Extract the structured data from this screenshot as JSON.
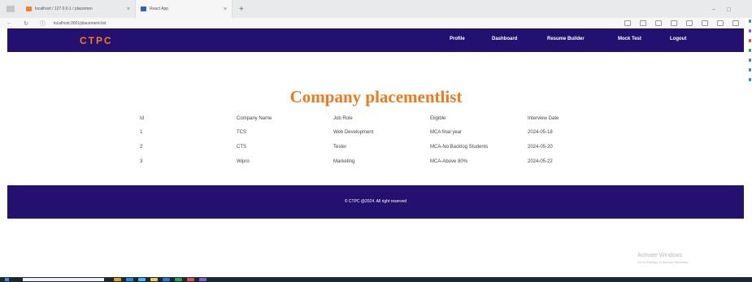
{
  "browser": {
    "tabs": [
      {
        "label": "localhost / 127.0.0.1 / placemen"
      },
      {
        "label": "React App"
      }
    ],
    "url": "localhost:3001/placement-list"
  },
  "navbar": {
    "brand": "CTPC",
    "links": [
      "Profile",
      "Dashboard",
      "Resume Builder",
      "Mock Test",
      "Logout"
    ],
    "bg_color": "#24106e",
    "brand_color": "#f0801b"
  },
  "page": {
    "title": "Company placementlist",
    "title_color": "#ee7a1c"
  },
  "table": {
    "headers": [
      "Id",
      "Company Name",
      "Job Role",
      "Eligible",
      "Interview Date"
    ],
    "rows": [
      [
        "1",
        "TCS",
        "Web Development",
        "MCA final year",
        "2024-05-18"
      ],
      [
        "2",
        "CTS",
        "Tester",
        "MCA-No Backlog Students",
        "2024-05-20"
      ],
      [
        "3",
        "Wipro",
        "Marketing",
        "MCA-Above 80%",
        "2024-05-22"
      ]
    ]
  },
  "footer": {
    "text": "© CTPC @2024. All right reserved"
  },
  "watermark": {
    "line1": "Activate Windows",
    "line2": "Go to Settings to activate Windows."
  }
}
